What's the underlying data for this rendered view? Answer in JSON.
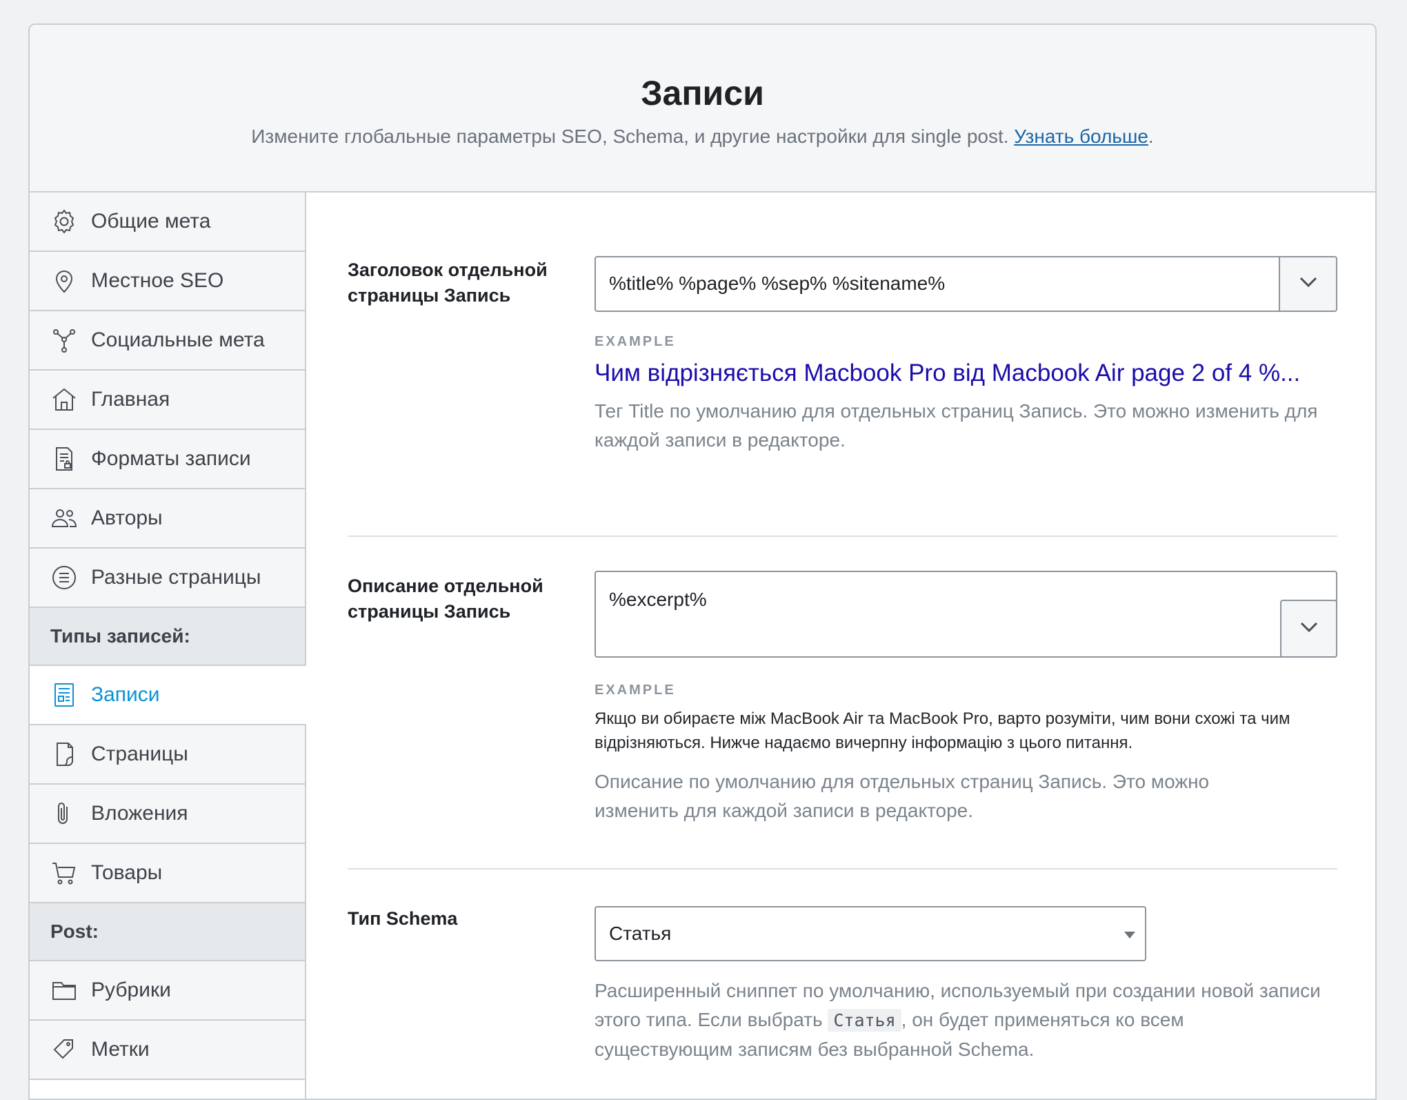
{
  "header": {
    "title": "Записи",
    "subtitle": "Измените глобальные параметры SEO, Schema, и другие настройки для single post.",
    "learn_more": "Узнать больше",
    "period": "."
  },
  "sidebar": {
    "items": [
      {
        "label": "Общие мета",
        "icon": "gear-icon"
      },
      {
        "label": "Местное SEO",
        "icon": "map-pin-icon"
      },
      {
        "label": "Социальные мета",
        "icon": "share-network-icon"
      },
      {
        "label": "Главная",
        "icon": "home-icon"
      },
      {
        "label": "Форматы записи",
        "icon": "document-lock-icon"
      },
      {
        "label": "Авторы",
        "icon": "users-icon"
      },
      {
        "label": "Разные страницы",
        "icon": "list-circle-icon"
      }
    ],
    "group_post_types": "Типы записей:",
    "post_types": [
      {
        "label": "Записи",
        "icon": "post-icon",
        "active": true
      },
      {
        "label": "Страницы",
        "icon": "page-icon"
      },
      {
        "label": "Вложения",
        "icon": "paperclip-icon"
      },
      {
        "label": "Товары",
        "icon": "cart-icon"
      }
    ],
    "group_post": "Post:",
    "taxonomies": [
      {
        "label": "Рубрики",
        "icon": "folder-icon"
      },
      {
        "label": "Метки",
        "icon": "tag-icon"
      }
    ]
  },
  "fields": {
    "title": {
      "label": "Заголовок отдельной страницы Запись",
      "value": "%title% %page% %sep% %sitename%",
      "example_tag": "EXAMPLE",
      "example": "Чим відрізняється Macbook Pro від Macbook Air page 2 of 4 %...",
      "help": "Тег Title по умолчанию для отдельных страниц Запись. Это можно изменить для каждой записи в редакторе."
    },
    "description": {
      "label": "Описание отдельной страницы Запись",
      "value": "%excerpt%",
      "example_tag": "EXAMPLE",
      "example": "Якщо ви обираєте між MacBook Air та MacBook Pro, варто розуміти, чим вони схожі та чим відрізняються. Нижче надаємо вичерпну інформацію з цього питання.",
      "help": "Описание по умолчанию для отдельных страниц Запись. Это можно изменить для каждой записи в редакторе."
    },
    "schema": {
      "label": "Тип Schema",
      "value": "Статья",
      "help_before": "Расширенный сниппет по умолчанию, используемый при создании новой записи этого типа. Если выбрать",
      "help_code": "Статья",
      "help_after": ", он будет применяться ко всем существующим записям без выбранной Schema."
    }
  },
  "colors": {
    "accent": "#0a91d6",
    "link": "#1b66a8",
    "example_title": "#1a0dab"
  }
}
